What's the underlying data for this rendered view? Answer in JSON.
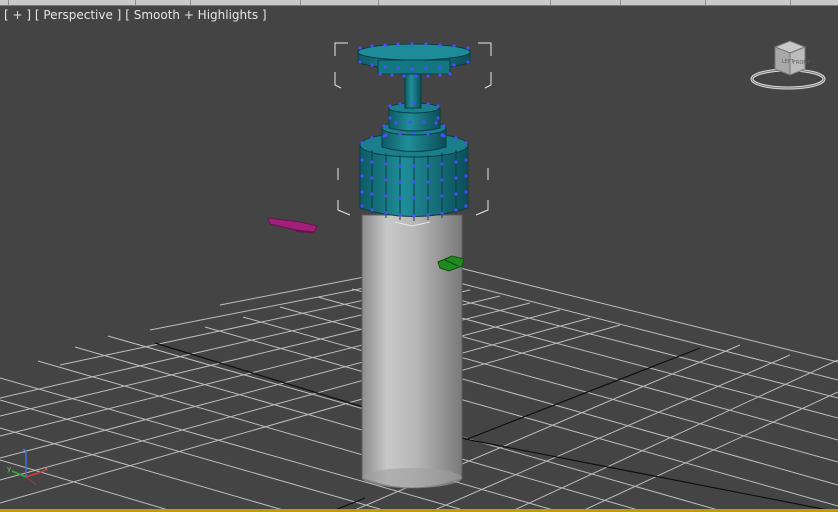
{
  "viewport": {
    "label_plus": "[ + ]",
    "label_view": "[ Perspective ]",
    "label_shading": "[ Smooth + Highlights ]"
  },
  "viewcube": {
    "left_face": "LEFT",
    "front_face": "FRONT"
  },
  "axis_tripod": {
    "x": "x",
    "y": "y",
    "z": "z"
  },
  "colors": {
    "viewport_bg": "#444444",
    "grid": "#bdbdbd",
    "grid_main": "#0f0f0f",
    "selection_bracket": "#e8e8e8",
    "cap_teal": "#1a7f8a",
    "vertex_blue": "#4d4dff",
    "body_grey": "#b8b8b8",
    "magenta_object": "#a0207a",
    "green_object": "#1f8a1f"
  },
  "icons": [
    "viewcube-icon",
    "axis-tripod-icon"
  ]
}
